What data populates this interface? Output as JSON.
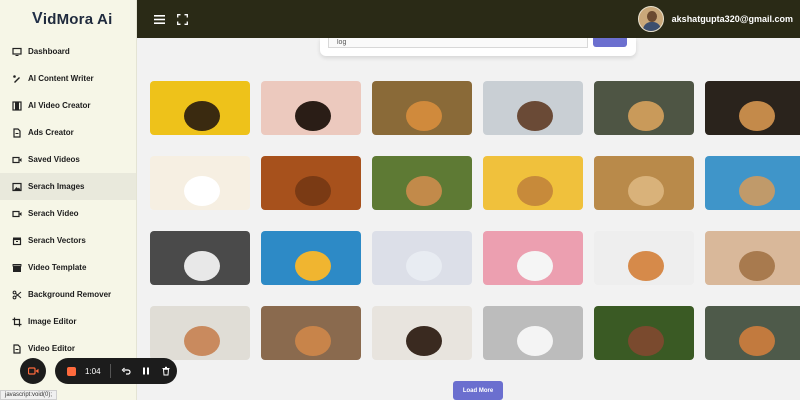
{
  "app": {
    "logo_initial": "V",
    "logo_rest": "idMora Ai"
  },
  "sidebar": {
    "items": [
      {
        "label": "Dashboard",
        "icon": "monitor-icon"
      },
      {
        "label": "AI Content Writer",
        "icon": "pen-icon"
      },
      {
        "label": "AI Video Creator",
        "icon": "film-icon"
      },
      {
        "label": "Ads Creator",
        "icon": "document-icon"
      },
      {
        "label": "Saved Videos",
        "icon": "video-icon"
      },
      {
        "label": "Serach Images",
        "icon": "image-icon",
        "active": true
      },
      {
        "label": "Serach Video",
        "icon": "video-icon"
      },
      {
        "label": "Serach Vectors",
        "icon": "archive-icon"
      },
      {
        "label": "Video Template",
        "icon": "clapper-icon"
      },
      {
        "label": "Background Remover",
        "icon": "scissors-icon"
      },
      {
        "label": "Image Editor",
        "icon": "crop-icon"
      },
      {
        "label": "Video Editor",
        "icon": "document-icon"
      }
    ]
  },
  "header": {
    "user_email": "akshatgupta320@gmail.com"
  },
  "search": {
    "value": "log"
  },
  "gallery": {
    "images": [
      {
        "bg": "#eec21a",
        "accent": "#3a2a10"
      },
      {
        "bg": "#ecc9be",
        "accent": "#2a1d16"
      },
      {
        "bg": "#8a6a38",
        "accent": "#d08a3c"
      },
      {
        "bg": "#c9cfd4",
        "accent": "#6a4a36"
      },
      {
        "bg": "#4e5544",
        "accent": "#c99a5a"
      },
      {
        "bg": "#2a231c",
        "accent": "#c48a4a"
      },
      {
        "bg": "#f6efe2",
        "accent": "#ffffff"
      },
      {
        "bg": "#a7511c",
        "accent": "#7a3a14"
      },
      {
        "bg": "#5e7a34",
        "accent": "#c28a4a"
      },
      {
        "bg": "#f0c13c",
        "accent": "#c78a3a"
      },
      {
        "bg": "#b98a4a",
        "accent": "#d9b27a"
      },
      {
        "bg": "#3f95c9",
        "accent": "#c09a6a"
      },
      {
        "bg": "#4a4a4a",
        "accent": "#e8e8e8"
      },
      {
        "bg": "#2d8ac6",
        "accent": "#f0b530"
      },
      {
        "bg": "#dcdfe8",
        "accent": "#e8ecf2"
      },
      {
        "bg": "#ec9fb0",
        "accent": "#f5f5f5"
      },
      {
        "bg": "#eeeeee",
        "accent": "#d68a4a"
      },
      {
        "bg": "#d9b89a",
        "accent": "#a87a4e"
      },
      {
        "bg": "#e0ddd6",
        "accent": "#c98a5e"
      },
      {
        "bg": "#8a6a4e",
        "accent": "#c8844a"
      },
      {
        "bg": "#e8e4de",
        "accent": "#3a2a20"
      },
      {
        "bg": "#bcbcbc",
        "accent": "#f4f4f4"
      },
      {
        "bg": "#3a5a24",
        "accent": "#7a4a2e"
      },
      {
        "bg": "#4e5a4a",
        "accent": "#c27a3e"
      }
    ],
    "load_more_label": "Load More"
  },
  "recorder": {
    "time": "1:04"
  },
  "status_bar": {
    "text": "javascript:void(0);"
  },
  "colors": {
    "topbar": "#2a2a16",
    "sidebar": "#f6f6e7",
    "accent": "#6b6fcf"
  }
}
